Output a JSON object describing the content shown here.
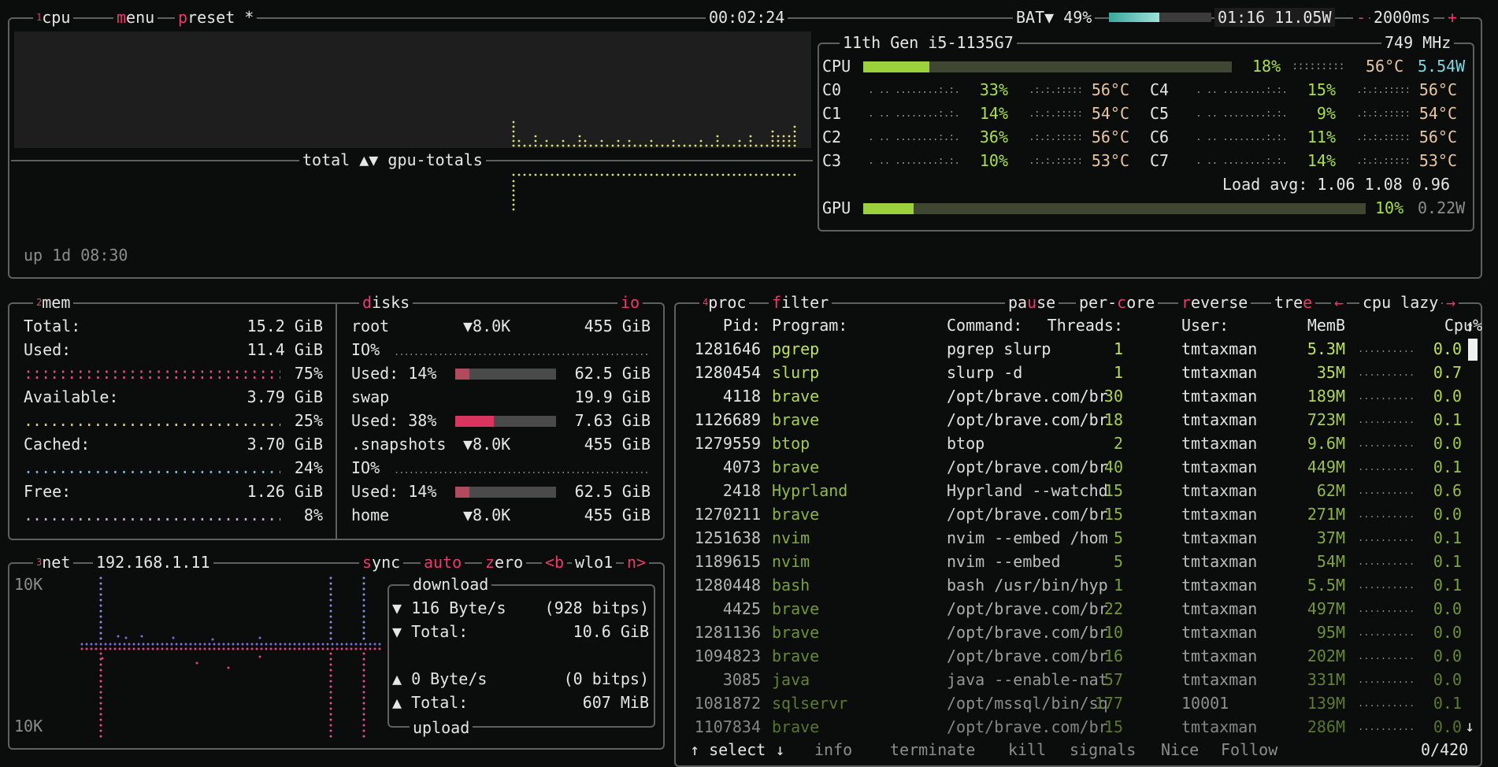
{
  "cpu_box": {
    "num": "1",
    "title": "cpu",
    "menu": "menu",
    "preset": "preset *",
    "clock": "00:02:24",
    "battery": "BAT▼ 49%",
    "battery_level": 0.49,
    "battery_time": "01:16 11.05W",
    "interval_minus": "-",
    "interval": "2000ms",
    "interval_plus": "+",
    "graph_label_left": "total",
    "graph_arrows": "▲▼",
    "graph_label_right": "gpu-totals",
    "uptime": "up 1d 08:30",
    "cpu_model": "11th Gen i5-1135G7",
    "freq": "749 MHz",
    "cpu_label": "CPU",
    "cpu_pct": "18%",
    "cpu_level": 0.18,
    "cpu_temp": "56°C",
    "cpu_watt": "5.54W",
    "cores": [
      {
        "name": "C0",
        "pct": "33%",
        "temp": "56°C"
      },
      {
        "name": "C1",
        "pct": "14%",
        "temp": "54°C"
      },
      {
        "name": "C2",
        "pct": "36%",
        "temp": "56°C"
      },
      {
        "name": "C3",
        "pct": "10%",
        "temp": "53°C"
      },
      {
        "name": "C4",
        "pct": "15%",
        "temp": "56°C"
      },
      {
        "name": "C5",
        "pct": "9%",
        "temp": "54°C"
      },
      {
        "name": "C6",
        "pct": "11%",
        "temp": "56°C"
      },
      {
        "name": "C7",
        "pct": "14%",
        "temp": "53°C"
      }
    ],
    "load_avg": "Load avg: 1.06 1.08 0.96",
    "gpu_label": "GPU",
    "gpu_pct": "10%",
    "gpu_level": 0.1,
    "gpu_watt": "0.22W"
  },
  "mem_box": {
    "num": "2",
    "title": "mem",
    "total_label": "Total:",
    "total_val": "15.2 GiB",
    "used_label": "Used:",
    "used_val": "11.4 GiB",
    "used_pct": "75%",
    "avail_label": "Available:",
    "avail_val": "3.79 GiB",
    "avail_pct": "25%",
    "cached_label": "Cached:",
    "cached_val": "3.70 GiB",
    "cached_pct": "24%",
    "free_label": "Free:",
    "free_val": "1.26 GiB",
    "free_pct": "8%"
  },
  "disks_box": {
    "title": "disks",
    "io": "io",
    "root_name": "root",
    "root_io": "▼8.0K",
    "root_size": "455 GiB",
    "root_io_label": "IO%",
    "root_used": "Used: 14%",
    "root_used_level": 0.14,
    "root_used_size": "62.5 GiB",
    "swap_name": "swap",
    "swap_size": "19.9 GiB",
    "swap_used": "Used: 38%",
    "swap_used_level": 0.38,
    "swap_used_size": "7.63 GiB",
    "snap_name": ".snapshots",
    "snap_io": "▼8.0K",
    "snap_size": "455 GiB",
    "snap_io_label": "IO%",
    "snap_used": "Used: 14%",
    "snap_used_level": 0.14,
    "snap_used_size": "62.5 GiB",
    "home_name": "home",
    "home_io": "▼8.0K",
    "home_size": "455 GiB"
  },
  "net_box": {
    "num": "3",
    "title": "net",
    "ip": "192.168.1.11",
    "sync": "sync",
    "auto": "auto",
    "zero": "zero",
    "prev": "<b",
    "iface": "wlo1",
    "next": "n>",
    "scale_top": "10K",
    "scale_bottom": "10K",
    "download_title": "download",
    "dl_rate": "▼ 116 Byte/s",
    "dl_bits": "(928 bitps)",
    "dl_total_label": "▼ Total:",
    "dl_total": "10.6 GiB",
    "ul_rate": "▲ 0 Byte/s",
    "ul_bits": "(0 bitps)",
    "ul_total_label": "▲ Total:",
    "ul_total": "607 MiB",
    "upload_title": "upload"
  },
  "proc_box": {
    "num": "4",
    "title": "proc",
    "filter": "filter",
    "pause": "pause",
    "per_core": "per-core",
    "reverse": "reverse",
    "tree": "tree",
    "sort_left": "←",
    "sort": "cpu lazy",
    "sort_right": "→",
    "headers": {
      "pid": "Pid:",
      "program": "Program:",
      "command": "Command:",
      "threads": "Threads:",
      "user": "User:",
      "memb": "MemB",
      "cpu": "Cpu%"
    },
    "rows": [
      {
        "pid": "1281646",
        "program": "pgrep",
        "command": "pgrep slurp",
        "threads": "1",
        "user": "tmtaxman",
        "mem": "5.3M",
        "cpu": "0.0"
      },
      {
        "pid": "1280454",
        "program": "slurp",
        "command": "slurp -d",
        "threads": "1",
        "user": "tmtaxman",
        "mem": "35M",
        "cpu": "0.7"
      },
      {
        "pid": "4118",
        "program": "brave",
        "command": "/opt/brave.com/br",
        "threads": "30",
        "user": "tmtaxman",
        "mem": "189M",
        "cpu": "0.0"
      },
      {
        "pid": "1126689",
        "program": "brave",
        "command": "/opt/brave.com/br",
        "threads": "18",
        "user": "tmtaxman",
        "mem": "723M",
        "cpu": "0.1"
      },
      {
        "pid": "1279559",
        "program": "btop",
        "command": "btop",
        "threads": "2",
        "user": "tmtaxman",
        "mem": "9.6M",
        "cpu": "0.0"
      },
      {
        "pid": "4073",
        "program": "brave",
        "command": "/opt/brave.com/br",
        "threads": "40",
        "user": "tmtaxman",
        "mem": "449M",
        "cpu": "0.1"
      },
      {
        "pid": "2418",
        "program": "Hyprland",
        "command": "Hyprland --watchd",
        "threads": "15",
        "user": "tmtaxman",
        "mem": "62M",
        "cpu": "0.6"
      },
      {
        "pid": "1270211",
        "program": "brave",
        "command": "/opt/brave.com/br",
        "threads": "15",
        "user": "tmtaxman",
        "mem": "271M",
        "cpu": "0.0"
      },
      {
        "pid": "1251638",
        "program": "nvim",
        "command": "nvim --embed /hom",
        "threads": "5",
        "user": "tmtaxman",
        "mem": "37M",
        "cpu": "0.1"
      },
      {
        "pid": "1189615",
        "program": "nvim",
        "command": "nvim --embed",
        "threads": "5",
        "user": "tmtaxman",
        "mem": "54M",
        "cpu": "0.1"
      },
      {
        "pid": "1280448",
        "program": "bash",
        "command": "bash /usr/bin/hyp",
        "threads": "1",
        "user": "tmtaxman",
        "mem": "5.5M",
        "cpu": "0.1"
      },
      {
        "pid": "4425",
        "program": "brave",
        "command": "/opt/brave.com/br",
        "threads": "22",
        "user": "tmtaxman",
        "mem": "497M",
        "cpu": "0.0"
      },
      {
        "pid": "1281136",
        "program": "brave",
        "command": "/opt/brave.com/br",
        "threads": "10",
        "user": "tmtaxman",
        "mem": "95M",
        "cpu": "0.0"
      },
      {
        "pid": "1094823",
        "program": "brave",
        "command": "/opt/brave.com/br",
        "threads": "16",
        "user": "tmtaxman",
        "mem": "202M",
        "cpu": "0.0"
      },
      {
        "pid": "3085",
        "program": "java",
        "command": "java --enable-nat",
        "threads": "57",
        "user": "tmtaxman",
        "mem": "331M",
        "cpu": "0.0"
      },
      {
        "pid": "1081872",
        "program": "sqlservr",
        "command": "/opt/mssql/bin/sq",
        "threads": "177",
        "user": "10001",
        "mem": "139M",
        "cpu": "0.1"
      },
      {
        "pid": "1107834",
        "program": "brave",
        "command": "/opt/brave.com/br",
        "threads": "15",
        "user": "tmtaxman",
        "mem": "286M",
        "cpu": "0.0"
      }
    ],
    "footer_select": "↑ select ↓",
    "footer_info": "info",
    "footer_terminate": "terminate",
    "footer_kill": "kill",
    "footer_signals": "signals",
    "footer_nice": "Nice",
    "footer_follow": "Follow",
    "count": "0/420",
    "scroll_up": "↑",
    "scroll_down": "↓"
  }
}
